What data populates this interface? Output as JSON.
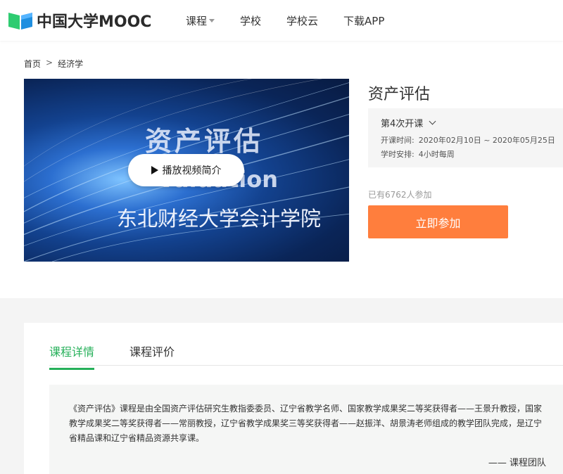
{
  "header": {
    "logo_text": "中国大学MOOC",
    "nav": [
      {
        "label": "课程",
        "has_dropdown": true
      },
      {
        "label": "学校",
        "has_dropdown": false
      },
      {
        "label": "学校云",
        "has_dropdown": false
      },
      {
        "label": "下载APP",
        "has_dropdown": false
      }
    ]
  },
  "breadcrumb": {
    "home": "首页",
    "separator": ">",
    "category": "经济学"
  },
  "video": {
    "title": "资产评估",
    "subtitle": "Valuation",
    "organization": "东北财经大学会计学院",
    "play_label": "播放视频简介"
  },
  "course": {
    "title": "资产评估",
    "term_select": "第4次开课",
    "start_label": "开课时间:",
    "start_value": "2020年02月10日 ~ 2020年05月25日",
    "schedule_label": "学时安排:",
    "schedule_value": "4小时每周",
    "participants": "已有6762人参加",
    "join_label": "立即参加"
  },
  "details": {
    "tabs": [
      {
        "label": "课程详情",
        "active": true
      },
      {
        "label": "课程评价",
        "active": false
      }
    ],
    "description": "《资产评估》课程是由全国资产评估研究生教指委委员、辽宁省教学名师、国家教学成果奖二等奖获得者——王景升教授，国家教学成果奖二等奖获得者——常丽教授，辽宁省教学成果奖三等奖获得者——赵振洋、胡景涛老师组成的教学团队完成，是辽宁省精品课和辽宁省精品资源共享课。",
    "author": "—— 课程团队"
  },
  "colors": {
    "accent_green": "#26b05a",
    "join_orange": "#ff7e3d"
  }
}
